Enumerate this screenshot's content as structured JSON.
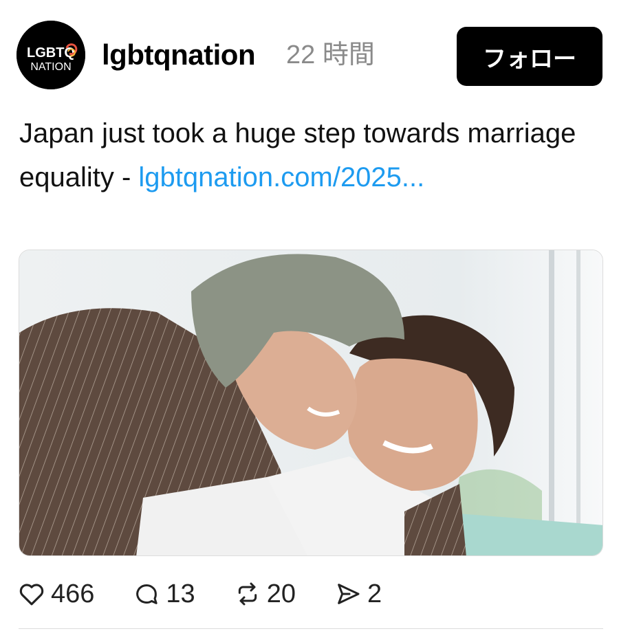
{
  "post": {
    "author": {
      "username": "lgbtqnation",
      "avatar_logo_line1": "LGBTQ",
      "avatar_logo_line2": "NATION"
    },
    "timestamp": "22 時間",
    "follow_label": "フォロー",
    "text": "Japan just took a huge step towards marriage equality - ",
    "link_text": "lgbtqnation.com/2025...",
    "image_icon": "photo-two-men-embracing",
    "stats": {
      "likes": "466",
      "replies": "13",
      "reposts": "20",
      "shares": "2"
    }
  },
  "icons": {
    "like": "heart-icon",
    "reply": "speech-bubble-icon",
    "repost": "repost-arrows-icon",
    "share": "send-icon"
  },
  "colors": {
    "link": "#1d9bf0",
    "timestamp": "#8a8a8a",
    "button_bg": "#000000",
    "button_text": "#ffffff"
  }
}
